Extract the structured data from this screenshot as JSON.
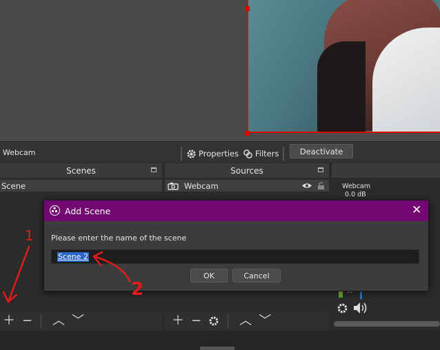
{
  "context_bar": {
    "source_name": "Webcam",
    "properties_label": "Properties",
    "filters_label": "Filters",
    "deactivate_label": "Deactivate"
  },
  "scenes": {
    "title": "Scenes",
    "items": [
      "Scene"
    ]
  },
  "sources": {
    "title": "Sources",
    "items": [
      {
        "label": "Webcam",
        "icon": "camera-icon"
      }
    ]
  },
  "mixer": {
    "source": "Webcam",
    "level": "0.0 dB",
    "meter_tick": "60"
  },
  "dialog": {
    "title": "Add Scene",
    "prompt": "Please enter the name of the scene",
    "input_value": "Scene 2",
    "ok_label": "OK",
    "cancel_label": "Cancel"
  },
  "annotations": {
    "step1": "1",
    "step2": "2"
  },
  "colors": {
    "dialog_titlebar": "#730873",
    "selection_red": "#e00000",
    "annotation_red": "#e21c1c",
    "text_selection": "#2a66c9"
  }
}
